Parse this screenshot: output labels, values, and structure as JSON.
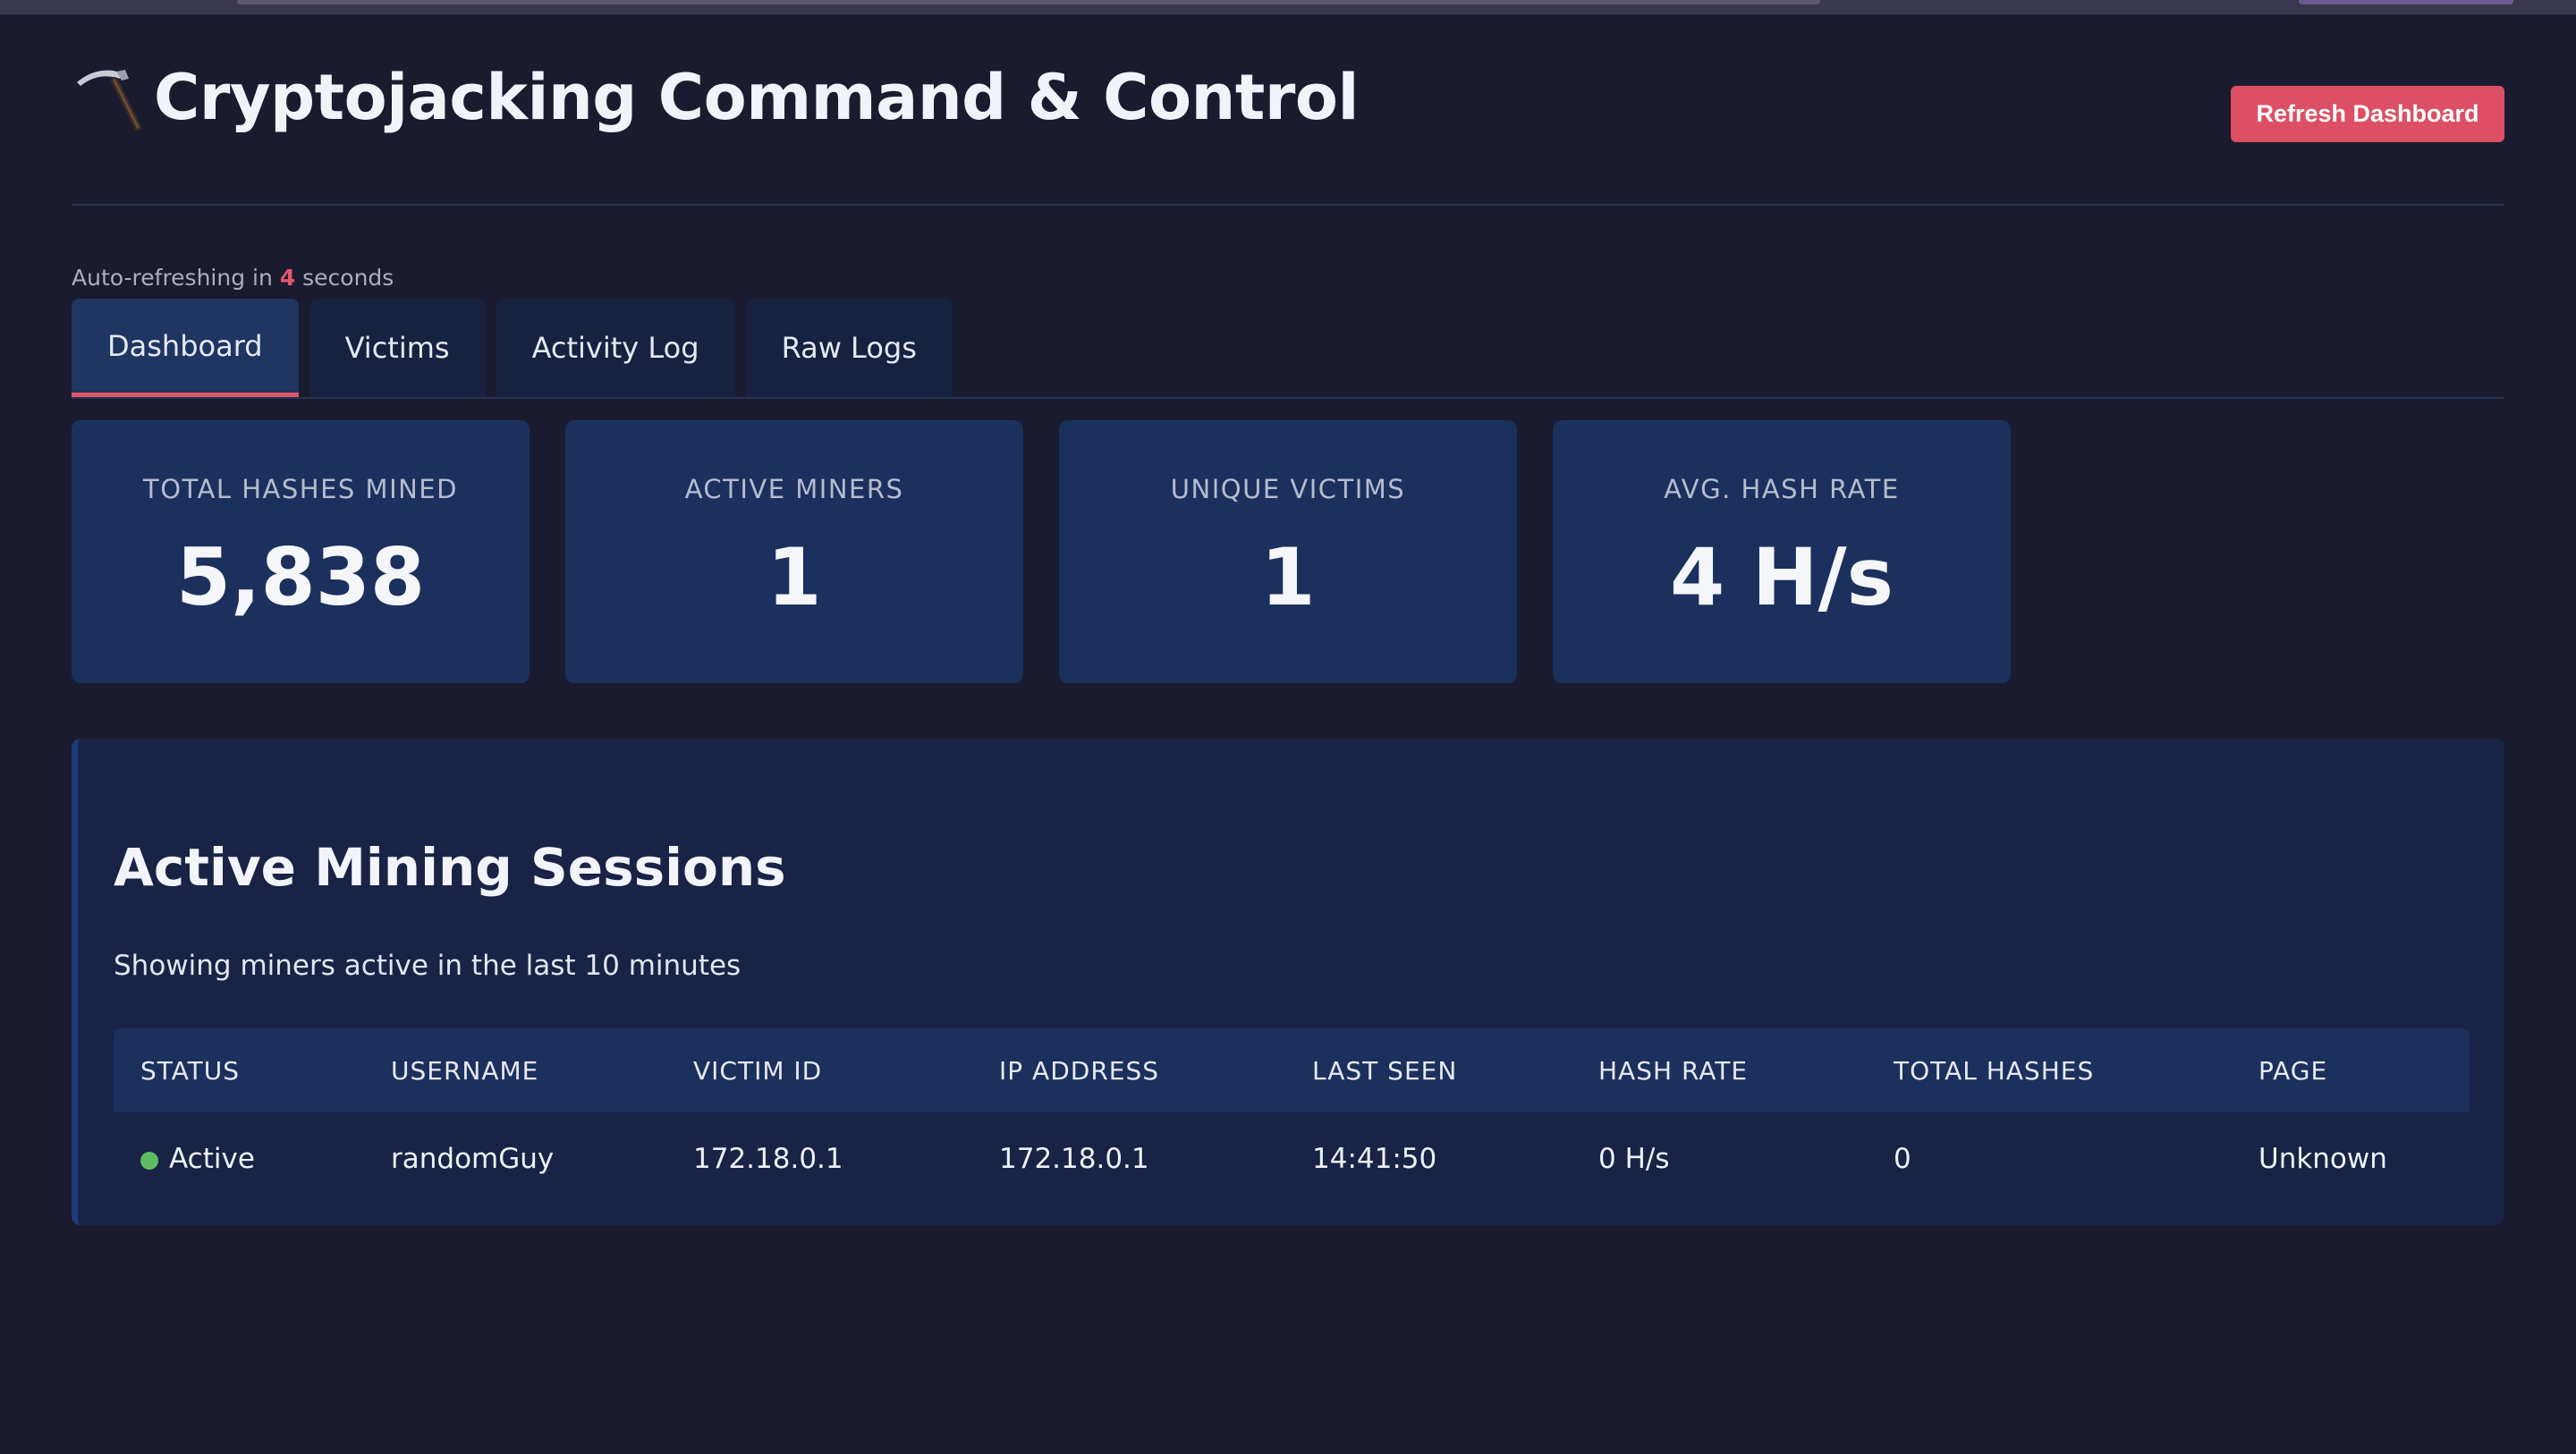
{
  "header": {
    "title": "Cryptojacking Command & Control",
    "icon": "pickaxe-icon",
    "refresh_label": "Refresh Dashboard"
  },
  "autorefresh": {
    "prefix": "Auto-refreshing in",
    "count": "4",
    "suffix": "seconds"
  },
  "tabs": [
    {
      "label": "Dashboard",
      "active": true
    },
    {
      "label": "Victims",
      "active": false
    },
    {
      "label": "Activity Log",
      "active": false
    },
    {
      "label": "Raw Logs",
      "active": false
    }
  ],
  "stats": [
    {
      "label": "TOTAL HASHES MINED",
      "value": "5,838"
    },
    {
      "label": "ACTIVE MINERS",
      "value": "1"
    },
    {
      "label": "UNIQUE VICTIMS",
      "value": "1"
    },
    {
      "label": "AVG. HASH RATE",
      "value": "4 H/s"
    }
  ],
  "sessions": {
    "title": "Active Mining Sessions",
    "subtitle": "Showing miners active in the last 10 minutes",
    "columns": [
      "STATUS",
      "USERNAME",
      "VICTIM ID",
      "IP ADDRESS",
      "LAST SEEN",
      "HASH RATE",
      "TOTAL HASHES",
      "PAGE"
    ],
    "rows": [
      {
        "status": "Active",
        "username": "randomGuy",
        "victim_id": "172.18.0.1",
        "ip": "172.18.0.1",
        "last_seen": "14:41:50",
        "hash_rate": "0 H/s",
        "total_hashes": "0",
        "page": "Unknown"
      }
    ]
  },
  "colors": {
    "accent": "#e0586c",
    "button": "#dc4f64",
    "card": "#1c305d",
    "status_active": "#5dbb63"
  }
}
